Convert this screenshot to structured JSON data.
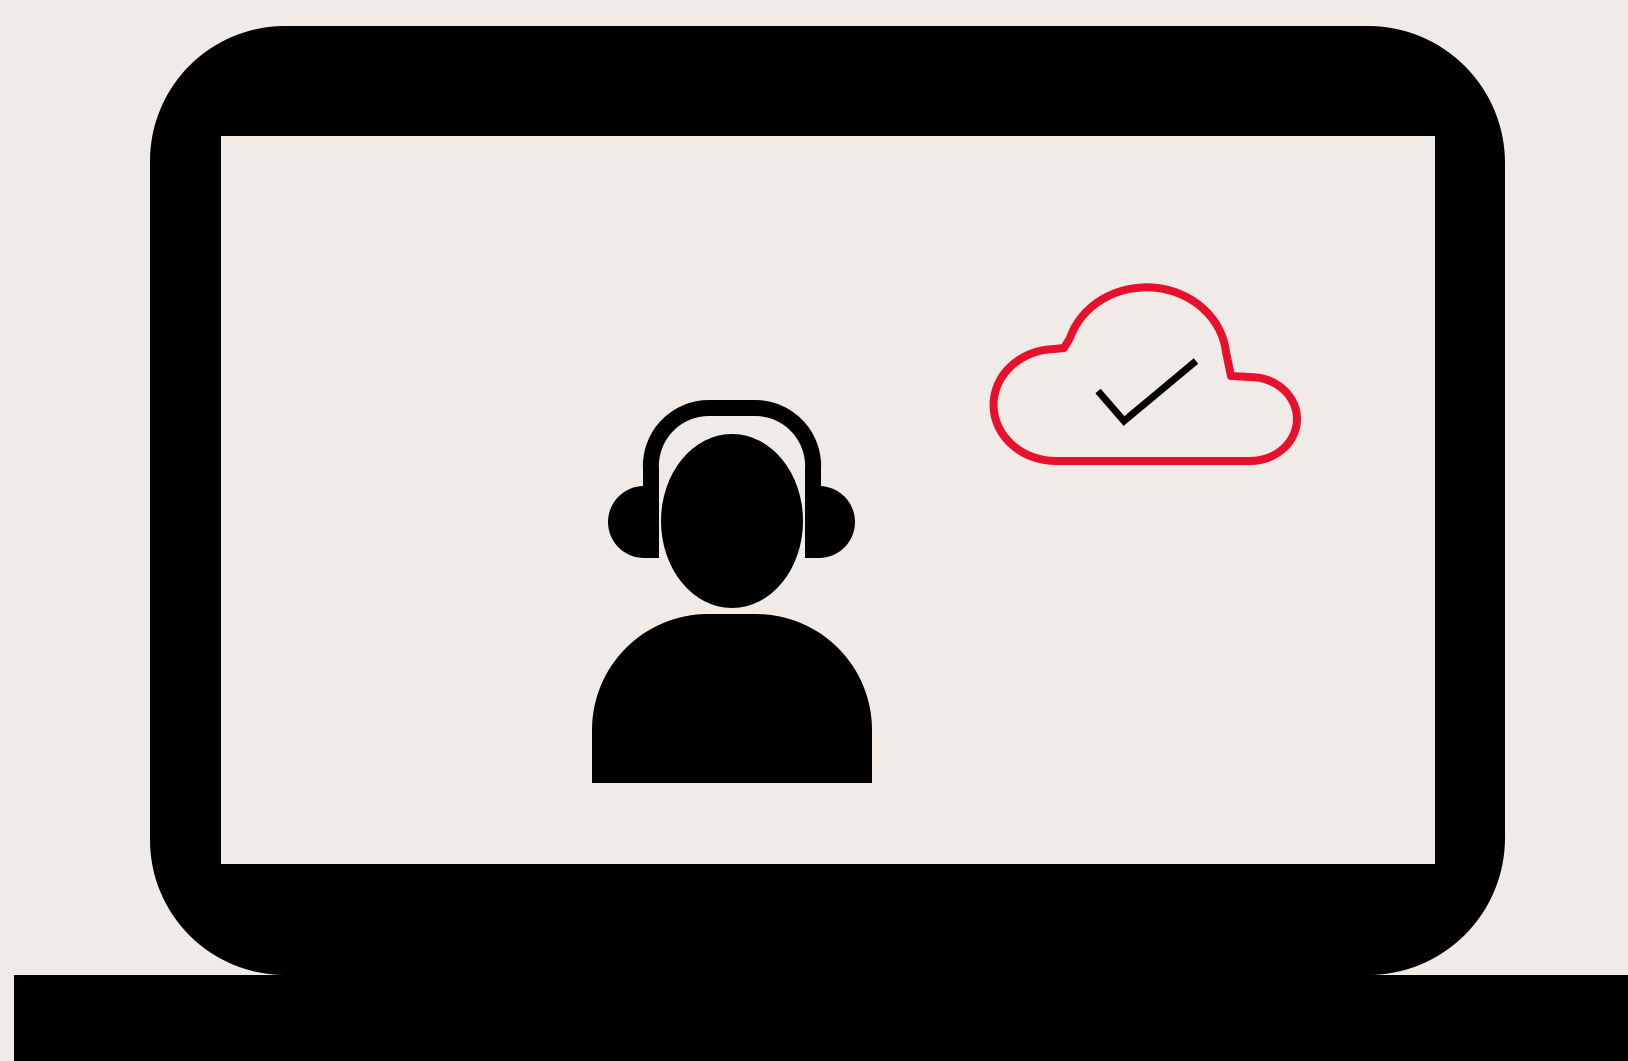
{
  "illustration": {
    "subject": "laptop-icon",
    "person_icon": "headset-user-icon",
    "status_icon": "cloud-check-icon"
  },
  "colors": {
    "background": "#f0ebe6",
    "ink": "#000000",
    "accent": "#e8112d"
  }
}
